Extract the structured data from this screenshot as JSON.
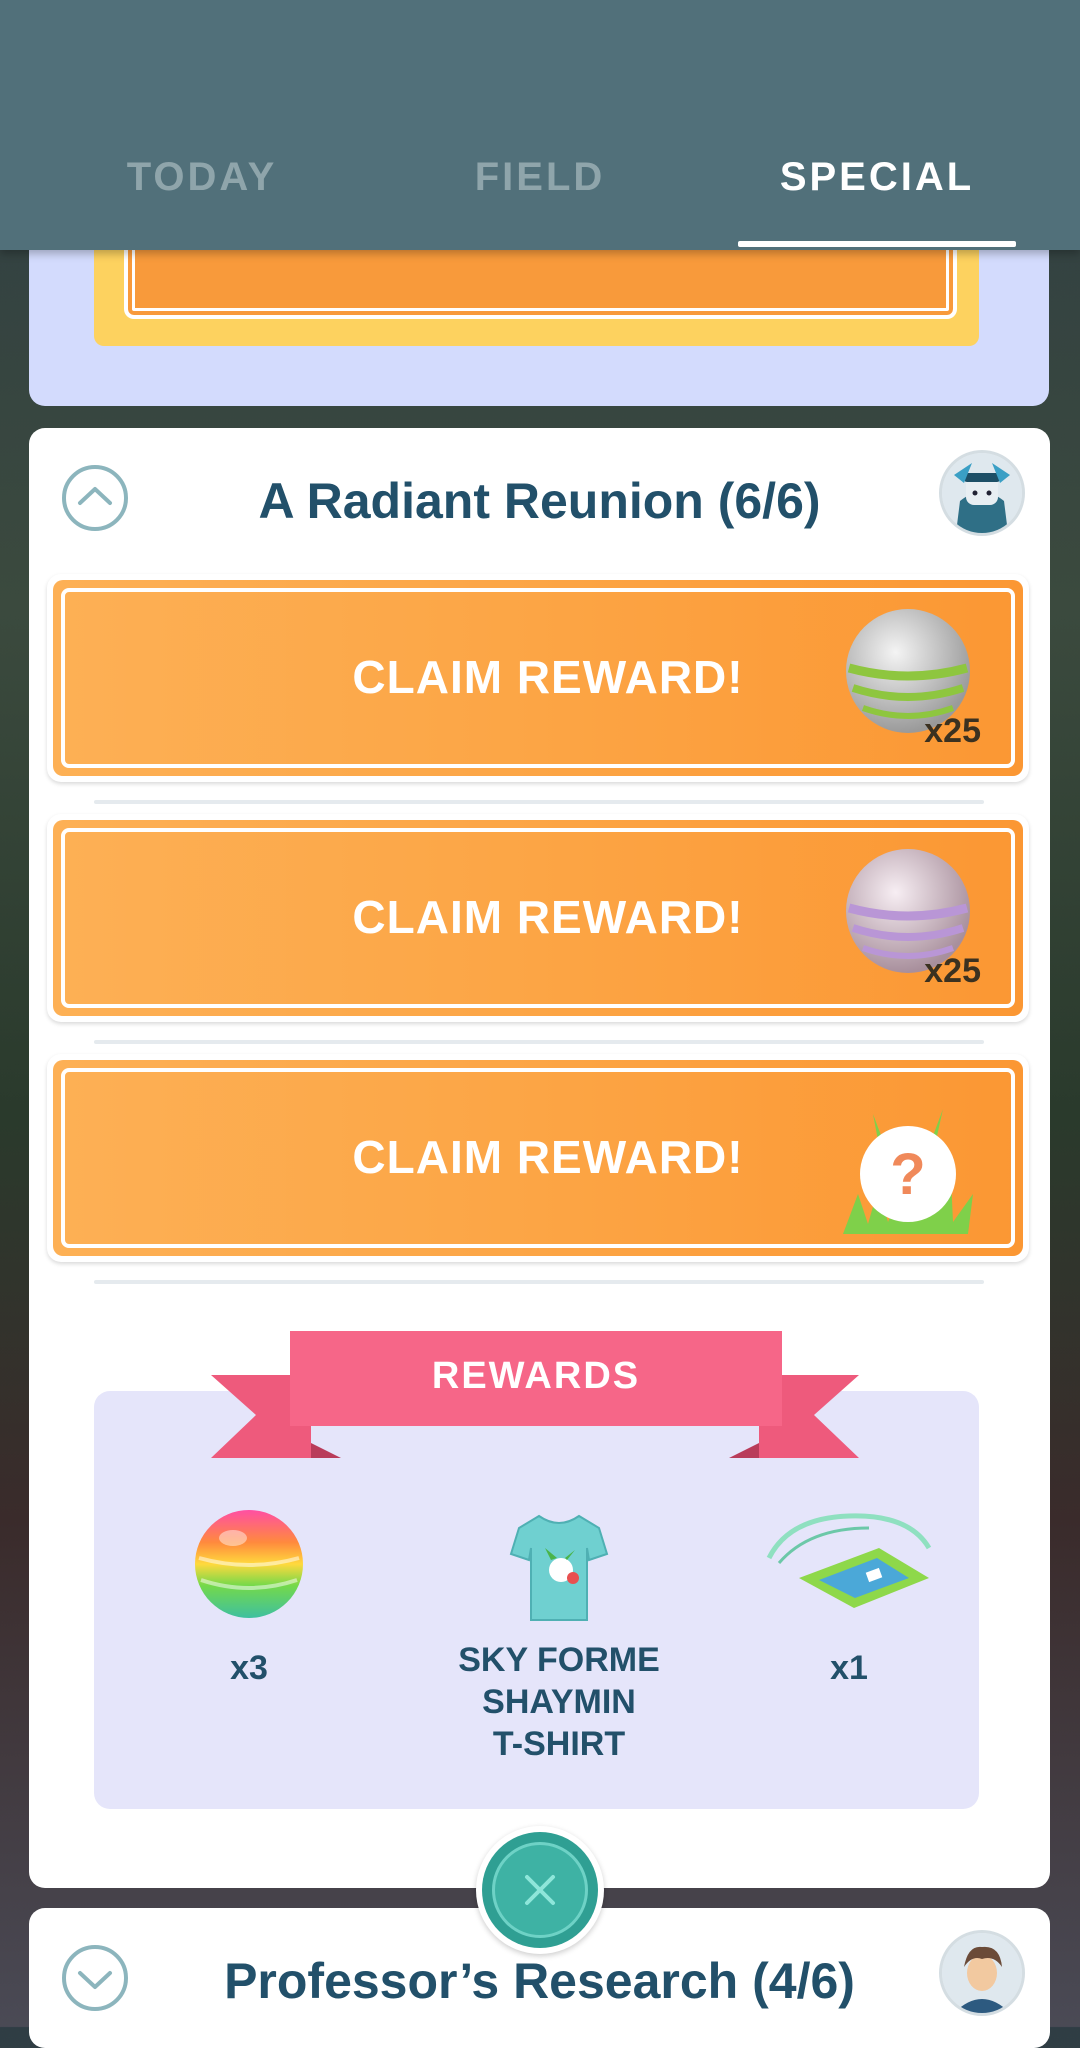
{
  "tabs": [
    {
      "label": "TODAY",
      "active": false
    },
    {
      "label": "FIELD",
      "active": false
    },
    {
      "label": "SPECIAL",
      "active": true
    }
  ],
  "research": {
    "title": "A Radiant Reunion (6/6)",
    "claims": [
      {
        "label": "CLAIM REWARD!",
        "reward_icon": "green-striped-ball-icon",
        "count": "x25"
      },
      {
        "label": "CLAIM REWARD!",
        "reward_icon": "purple-striped-ball-icon",
        "count": "x25"
      },
      {
        "label": "CLAIM REWARD!",
        "reward_icon": "mystery-encounter-icon",
        "count": ""
      }
    ],
    "rewards_banner": "REWARDS",
    "rewards": [
      {
        "icon": "rainbow-ball-icon",
        "text": "x3"
      },
      {
        "icon": "tshirt-icon",
        "text": "SKY FORME\nSHAYMIN\nT-SHIRT"
      },
      {
        "icon": "ticket-pass-icon",
        "text": "x1"
      }
    ]
  },
  "next_research": {
    "title": "Professor’s Research (4/6)"
  },
  "colors": {
    "header": "#51707a",
    "claim_orange": "#fca545",
    "ribbon": "#f66688",
    "title_text": "#22506a",
    "rewards_bg": "#e5e5fa"
  }
}
